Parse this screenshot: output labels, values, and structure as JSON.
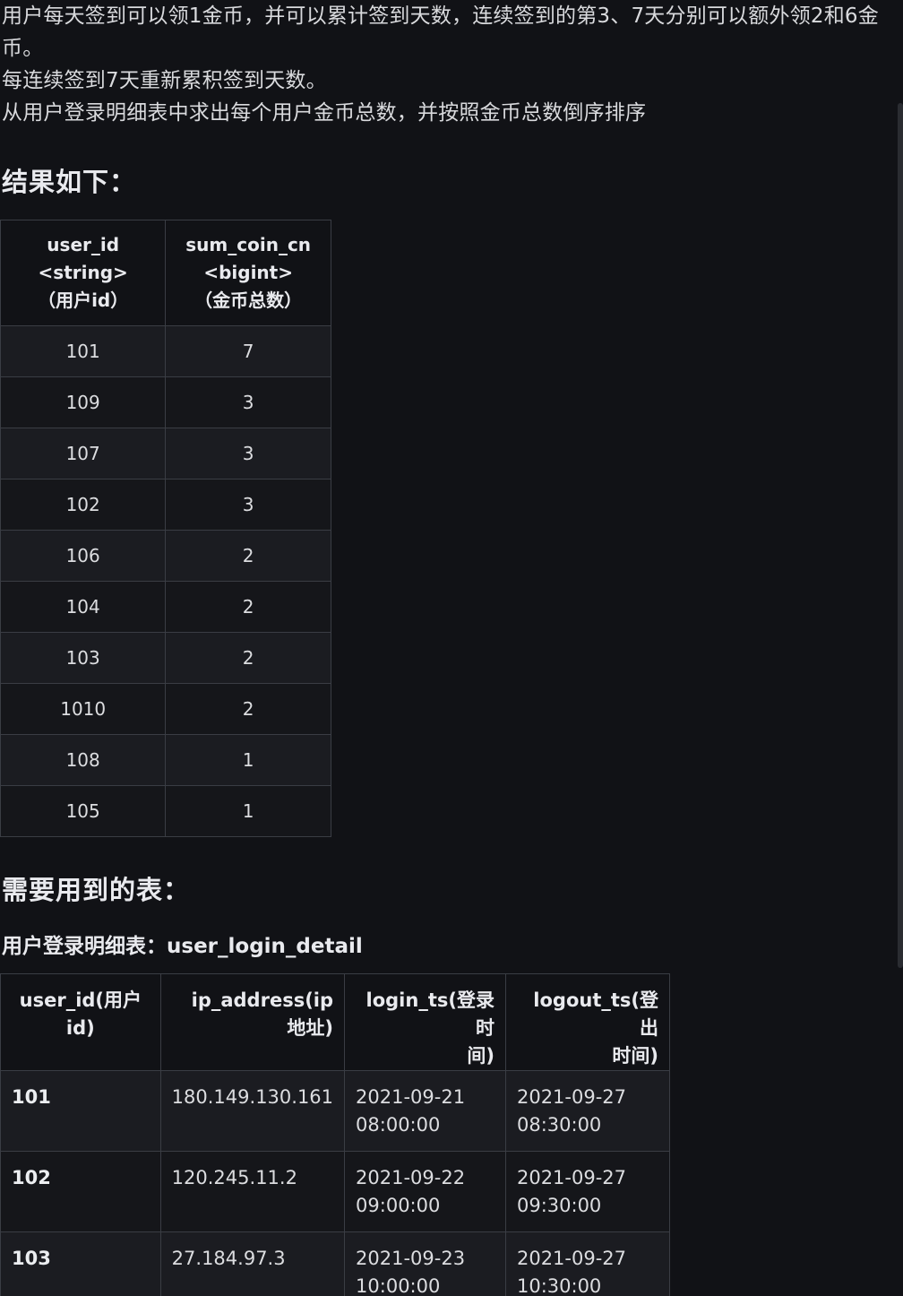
{
  "intro": {
    "line1": "用户每天签到可以领1金币，并可以累计签到天数，连续签到的第3、7天分别可以额外领2和6金币。",
    "line2": "每连续签到7天重新累积签到天数。",
    "line3": "从用户登录明细表中求出每个用户金币总数，并按照金币总数倒序排序"
  },
  "result": {
    "heading": "结果如下：",
    "headers": [
      [
        "user_id",
        "<string>",
        "（用户id）"
      ],
      [
        "sum_coin_cn",
        "<bigint>",
        "（金币总数）"
      ]
    ],
    "rows": [
      [
        "101",
        "7"
      ],
      [
        "109",
        "3"
      ],
      [
        "107",
        "3"
      ],
      [
        "102",
        "3"
      ],
      [
        "106",
        "2"
      ],
      [
        "104",
        "2"
      ],
      [
        "103",
        "2"
      ],
      [
        "1010",
        "2"
      ],
      [
        "108",
        "1"
      ],
      [
        "105",
        "1"
      ]
    ]
  },
  "tables": {
    "heading": "需要用到的表：",
    "subheading": "用户登录明细表：user_login_detail",
    "headers": [
      [
        "user_id(用户id)"
      ],
      [
        "ip_address(ip",
        "地址)"
      ],
      [
        "login_ts(登录时",
        "间)"
      ],
      [
        "logout_ts(登出",
        "时间)"
      ]
    ],
    "rows": [
      [
        "101",
        "180.149.130.161",
        [
          "2021-09-21",
          "08:00:00"
        ],
        [
          "2021-09-27",
          "08:30:00"
        ]
      ],
      [
        "102",
        "120.245.11.2",
        [
          "2021-09-22",
          "09:00:00"
        ],
        [
          "2021-09-27",
          "09:30:00"
        ]
      ],
      [
        "103",
        "27.184.97.3",
        [
          "2021-09-23",
          "10:00:00"
        ],
        [
          "2021-09-27",
          "10:30:00"
        ]
      ]
    ]
  }
}
